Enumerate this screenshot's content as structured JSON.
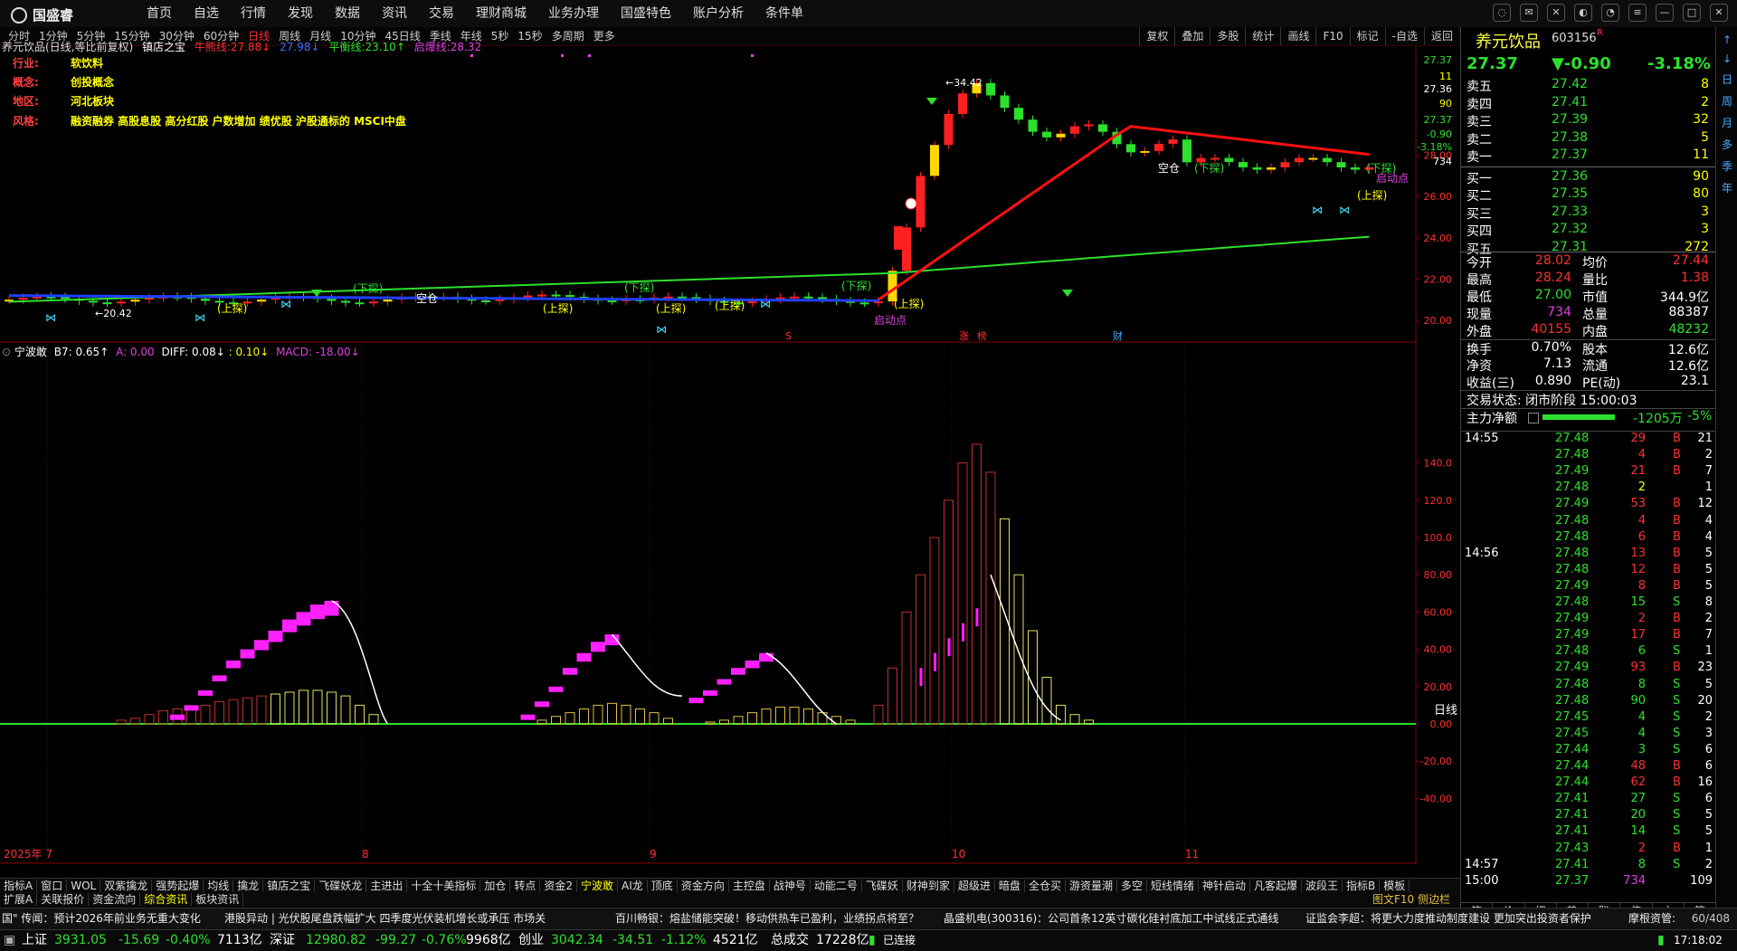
{
  "app": {
    "logo_text": "国盛睿"
  },
  "menu": [
    "首页",
    "自选",
    "行情",
    "发现",
    "数据",
    "资讯",
    "交易",
    "理财商城",
    "业务办理",
    "国盛特色",
    "账户分析",
    "条件单"
  ],
  "periods": [
    {
      "label": "分时",
      "active": false
    },
    {
      "label": "1分钟",
      "active": false
    },
    {
      "label": "5分钟",
      "active": false
    },
    {
      "label": "15分钟",
      "active": false
    },
    {
      "label": "30分钟",
      "active": false
    },
    {
      "label": "60分钟",
      "active": false
    },
    {
      "label": "日线",
      "active": true
    },
    {
      "label": "周线",
      "active": false
    },
    {
      "label": "月线",
      "active": false
    },
    {
      "label": "10分钟",
      "active": false
    },
    {
      "label": "45日线",
      "active": false
    },
    {
      "label": "季线",
      "active": false
    },
    {
      "label": "年线",
      "active": false
    },
    {
      "label": "5秒",
      "active": false
    },
    {
      "label": "15秒",
      "active": false
    },
    {
      "label": "多周期",
      "active": false
    },
    {
      "label": "更多",
      "active": false
    }
  ],
  "tools": [
    "复权",
    "叠加",
    "多股",
    "统计",
    "画线",
    "F10",
    "标记",
    "-自选",
    "返回"
  ],
  "stock_header": {
    "title": "养元饮品(日线,等比前复权)",
    "indicator": "镇店之宝",
    "line1_label": "牛熊线:",
    "line1_val": "27.88",
    "line2_val": "27.98",
    "line3_label": "平衡线:",
    "line3_val": "23.10",
    "line4_label": "启爆线:",
    "line4_val": "28.32"
  },
  "info": {
    "industry_label": "行业:",
    "industry": "软饮料",
    "concept_label": "概念:",
    "concept": "创投概念",
    "region_label": "地区:",
    "region": "河北板块",
    "style_label": "风格:",
    "style": "融资融券 高股息股 高分红股 户数增加 绩优股 沪股通标的 MSCI中盘"
  },
  "price_axis": [
    "28.00",
    "26.00",
    "24.00",
    "22.00",
    "20.00"
  ],
  "price_axis_top": [
    "27.37",
    "11",
    "27.36",
    "90",
    "27.37",
    "-0.90",
    "-3.18%",
    "734"
  ],
  "chart_annotations": {
    "high": "34.42",
    "low": "20.42",
    "xiadie": "(下探)",
    "shangtan": "(上探)",
    "kongcang": "空仓",
    "qidong": "启动点",
    "xingzhang": "涨"
  },
  "event_marks": [
    "S",
    "涨",
    "榜",
    "财"
  ],
  "sub_header": {
    "name": "宁波敢",
    "b7": "B7: 0.65",
    "a": "A: 0.00",
    "diff": "DIFF: 0.08",
    "dea": ": 0.10",
    "macd": "MACD: -18.00"
  },
  "sub_axis": [
    "140.0",
    "120.0",
    "100.0",
    "80.00",
    "60.00",
    "40.00",
    "20.00",
    "0.00",
    "-20.00",
    "-40.00"
  ],
  "date_axis": [
    {
      "label": "2025年 7"
    },
    {
      "label": "8"
    },
    {
      "label": "9"
    },
    {
      "label": "10"
    },
    {
      "label": "11"
    }
  ],
  "period_name": "日线",
  "tabs1": [
    "指标A",
    "窗口",
    "WOL",
    "双紫擒龙",
    "强势起爆",
    "均线",
    "擒龙",
    "镇店之宝",
    "飞碟妖龙",
    "主进出",
    "十全十美指标",
    "加仓",
    "转点",
    "资金2",
    "宁波敢",
    "AI龙",
    "顶底",
    "资金方向",
    "主控盘",
    "战神号",
    "动能二号",
    "飞碟妖",
    "财神到家",
    "超级进",
    "暗盘",
    "全仓买",
    "游资量潮",
    "多空",
    "短线情绪",
    "神针启动",
    "凡客起爆",
    "波段王",
    "指标B",
    "模板"
  ],
  "tabs2": [
    "扩展A",
    "关联报价",
    "资金流向",
    "综合资讯",
    "板块资讯"
  ],
  "tabs2_right": "图文F10 侧边栏",
  "quote": {
    "name": "养元饮品",
    "code": "603156",
    "badge": "R",
    "price": "27.37",
    "change": "▼-0.90",
    "pct": "-3.18%"
  },
  "asks": [
    {
      "label": "卖五",
      "price": "27.42",
      "vol": "8"
    },
    {
      "label": "卖四",
      "price": "27.41",
      "vol": "2"
    },
    {
      "label": "卖三",
      "price": "27.39",
      "vol": "32"
    },
    {
      "label": "卖二",
      "price": "27.38",
      "vol": "5"
    },
    {
      "label": "卖一",
      "price": "27.37",
      "vol": "11"
    }
  ],
  "bids": [
    {
      "label": "买一",
      "price": "27.36",
      "vol": "90"
    },
    {
      "label": "买二",
      "price": "27.35",
      "vol": "80"
    },
    {
      "label": "买三",
      "price": "27.33",
      "vol": "3"
    },
    {
      "label": "买四",
      "price": "27.32",
      "vol": "3"
    },
    {
      "label": "买五",
      "price": "27.31",
      "vol": "272"
    }
  ],
  "stats": [
    {
      "l1": "今开",
      "v1": "28.02",
      "l2": "均价",
      "v2": "27.44"
    },
    {
      "l1": "最高",
      "v1": "28.24",
      "l2": "量比",
      "v2": "1.38"
    },
    {
      "l1": "最低",
      "v1": "27.00",
      "l2": "市值",
      "v2": "344.9亿"
    },
    {
      "l1": "现量",
      "v1": "734",
      "l2": "总量",
      "v2": "88387"
    },
    {
      "l1": "外盘",
      "v1": "40155",
      "l2": "内盘",
      "v2": "48232"
    },
    {
      "l1": "换手",
      "v1": "0.70%",
      "l2": "股本",
      "v2": "12.6亿"
    },
    {
      "l1": "净资",
      "v1": "7.13",
      "l2": "流通",
      "v2": "12.6亿"
    },
    {
      "l1": "收益(三)",
      "v1": "0.890",
      "l2": "PE(动)",
      "v2": "23.1"
    }
  ],
  "trade_status": "交易状态: 闭市阶段 15:00:03",
  "main_flow": {
    "label": "主力净额",
    "value": "-1205万",
    "pct": "-5%"
  },
  "ticks": [
    {
      "time": "14:55",
      "price": "27.48",
      "vol": "29",
      "bs": "B",
      "n": "21"
    },
    {
      "time": "",
      "price": "27.48",
      "vol": "4",
      "bs": "B",
      "n": "2"
    },
    {
      "time": "",
      "price": "27.49",
      "vol": "21",
      "bs": "B",
      "n": "7"
    },
    {
      "time": "",
      "price": "27.48",
      "vol": "2",
      "bs": "",
      "n": "1"
    },
    {
      "time": "",
      "price": "27.49",
      "vol": "53",
      "bs": "B",
      "n": "12"
    },
    {
      "time": "",
      "price": "27.48",
      "vol": "4",
      "bs": "B",
      "n": "4"
    },
    {
      "time": "",
      "price": "27.48",
      "vol": "6",
      "bs": "B",
      "n": "4"
    },
    {
      "time": "14:56",
      "price": "27.48",
      "vol": "13",
      "bs": "B",
      "n": "5"
    },
    {
      "time": "",
      "price": "27.48",
      "vol": "12",
      "bs": "B",
      "n": "5"
    },
    {
      "time": "",
      "price": "27.49",
      "vol": "8",
      "bs": "B",
      "n": "5"
    },
    {
      "time": "",
      "price": "27.48",
      "vol": "15",
      "bs": "S",
      "n": "8"
    },
    {
      "time": "",
      "price": "27.49",
      "vol": "2",
      "bs": "B",
      "n": "2"
    },
    {
      "time": "",
      "price": "27.49",
      "vol": "17",
      "bs": "B",
      "n": "7"
    },
    {
      "time": "",
      "price": "27.48",
      "vol": "6",
      "bs": "S",
      "n": "1"
    },
    {
      "time": "",
      "price": "27.49",
      "vol": "93",
      "bs": "B",
      "n": "23"
    },
    {
      "time": "",
      "price": "27.48",
      "vol": "8",
      "bs": "S",
      "n": "5"
    },
    {
      "time": "",
      "price": "27.48",
      "vol": "90",
      "bs": "S",
      "n": "20"
    },
    {
      "time": "",
      "price": "27.45",
      "vol": "4",
      "bs": "S",
      "n": "2"
    },
    {
      "time": "",
      "price": "27.45",
      "vol": "4",
      "bs": "S",
      "n": "3"
    },
    {
      "time": "",
      "price": "27.44",
      "vol": "3",
      "bs": "S",
      "n": "6"
    },
    {
      "time": "",
      "price": "27.44",
      "vol": "48",
      "bs": "B",
      "n": "6"
    },
    {
      "time": "",
      "price": "27.44",
      "vol": "62",
      "bs": "B",
      "n": "16"
    },
    {
      "time": "",
      "price": "27.41",
      "vol": "27",
      "bs": "S",
      "n": "6"
    },
    {
      "time": "",
      "price": "27.41",
      "vol": "20",
      "bs": "S",
      "n": "5"
    },
    {
      "time": "",
      "price": "27.41",
      "vol": "14",
      "bs": "S",
      "n": "5"
    },
    {
      "time": "",
      "price": "27.43",
      "vol": "2",
      "bs": "B",
      "n": "1"
    },
    {
      "time": "14:57",
      "price": "27.41",
      "vol": "8",
      "bs": "S",
      "n": "2"
    },
    {
      "time": "15:00",
      "price": "27.37",
      "vol": "734",
      "bs": "",
      "n": "109"
    }
  ],
  "rp_tabs": [
    "笔",
    "价",
    "细",
    "势",
    "联",
    "值",
    "主",
    "筹"
  ],
  "side_tabs": [
    "↑",
    "↓",
    "日",
    "周",
    "月",
    "多",
    "季",
    "年"
  ],
  "news": [
    "国\" 传闻：预计2026年前业务无重大变化",
    "港股异动 | 光伏股尾盘跌幅扩大 四季度光伏装机增长或承压 市场关",
    "百川畅银：熔盐储能突破！移动供热车已盈利，业绩拐点将至？",
    "晶盛机电(300316)：公司首条12英寸碳化硅衬底加工中试线正式通线",
    "证监会李超：将更大力度推动制度建设 更加突出投资者保护",
    "摩根资管:"
  ],
  "news_right": "60/408",
  "status": {
    "sh_label": "上证",
    "sh": "3931.05",
    "sh_chg": "-15.69",
    "sh_pct": "-0.40%",
    "sh_amt": "7113亿",
    "sz_label": "深证",
    "sz": "12980.82",
    "sz_chg": "-99.27",
    "sz_pct": "-0.76%",
    "sz_amt": "9968亿",
    "cy_label": "创业",
    "cy": "3042.34",
    "cy_chg": "-34.51",
    "cy_pct": "-1.12%",
    "cy_amt": "4521亿",
    "total_label": "总成交",
    "total": "17228亿",
    "conn": "已连接",
    "time": "17:18:02"
  }
}
